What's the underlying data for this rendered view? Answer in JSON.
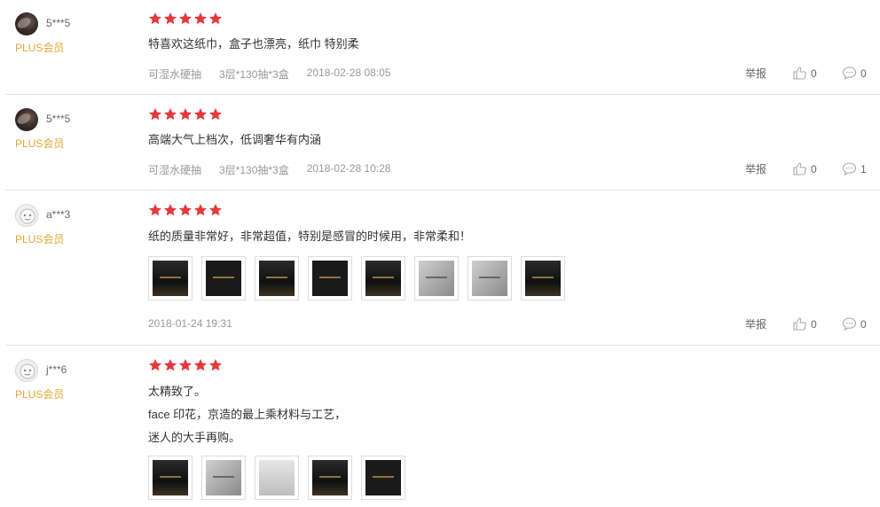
{
  "reviews": [
    {
      "username": "5***5",
      "avatar": "dark-photo-avatar",
      "member": "PLUS会员",
      "rating": 5,
      "content": [
        "特喜欢这纸巾，盒子也漂亮，纸巾 特别柔"
      ],
      "product_type": "可湿水硬抽",
      "spec": "3层*130抽*3盒",
      "date": "2018-02-28 08:05",
      "report_label": "举报",
      "likes": "0",
      "comments": "0",
      "images": 0
    },
    {
      "username": "5***5",
      "avatar": "dark-photo-avatar",
      "member": "PLUS会员",
      "rating": 5,
      "content": [
        "高端大气上档次，低调奢华有内涵"
      ],
      "product_type": "可湿水硬抽",
      "spec": "3层*130抽*3盒",
      "date": "2018-02-28 10:28",
      "report_label": "举报",
      "likes": "0",
      "comments": "1",
      "images": 0
    },
    {
      "username": "a***3",
      "avatar": "default-avatar",
      "member": "PLUS会员",
      "rating": 5,
      "content": [
        "纸的质量非常好，非常超值，特别是感冒的时候用，非常柔和！"
      ],
      "date": "2018-01-24 19:31",
      "report_label": "举报",
      "likes": "0",
      "comments": "0",
      "images": 8
    },
    {
      "username": "j***6",
      "avatar": "default-avatar",
      "member": "PLUS会员",
      "rating": 5,
      "content": [
        "太精致了。",
        "face 印花，京造的最上乘材料与工艺，",
        "迷人的大手再购。"
      ],
      "images": 5
    }
  ],
  "colors": {
    "star": "#e4393c",
    "plus": "#e4a734",
    "meta": "#999999"
  },
  "icons": [
    "star-icon",
    "thumbs-up-icon",
    "comment-icon"
  ]
}
